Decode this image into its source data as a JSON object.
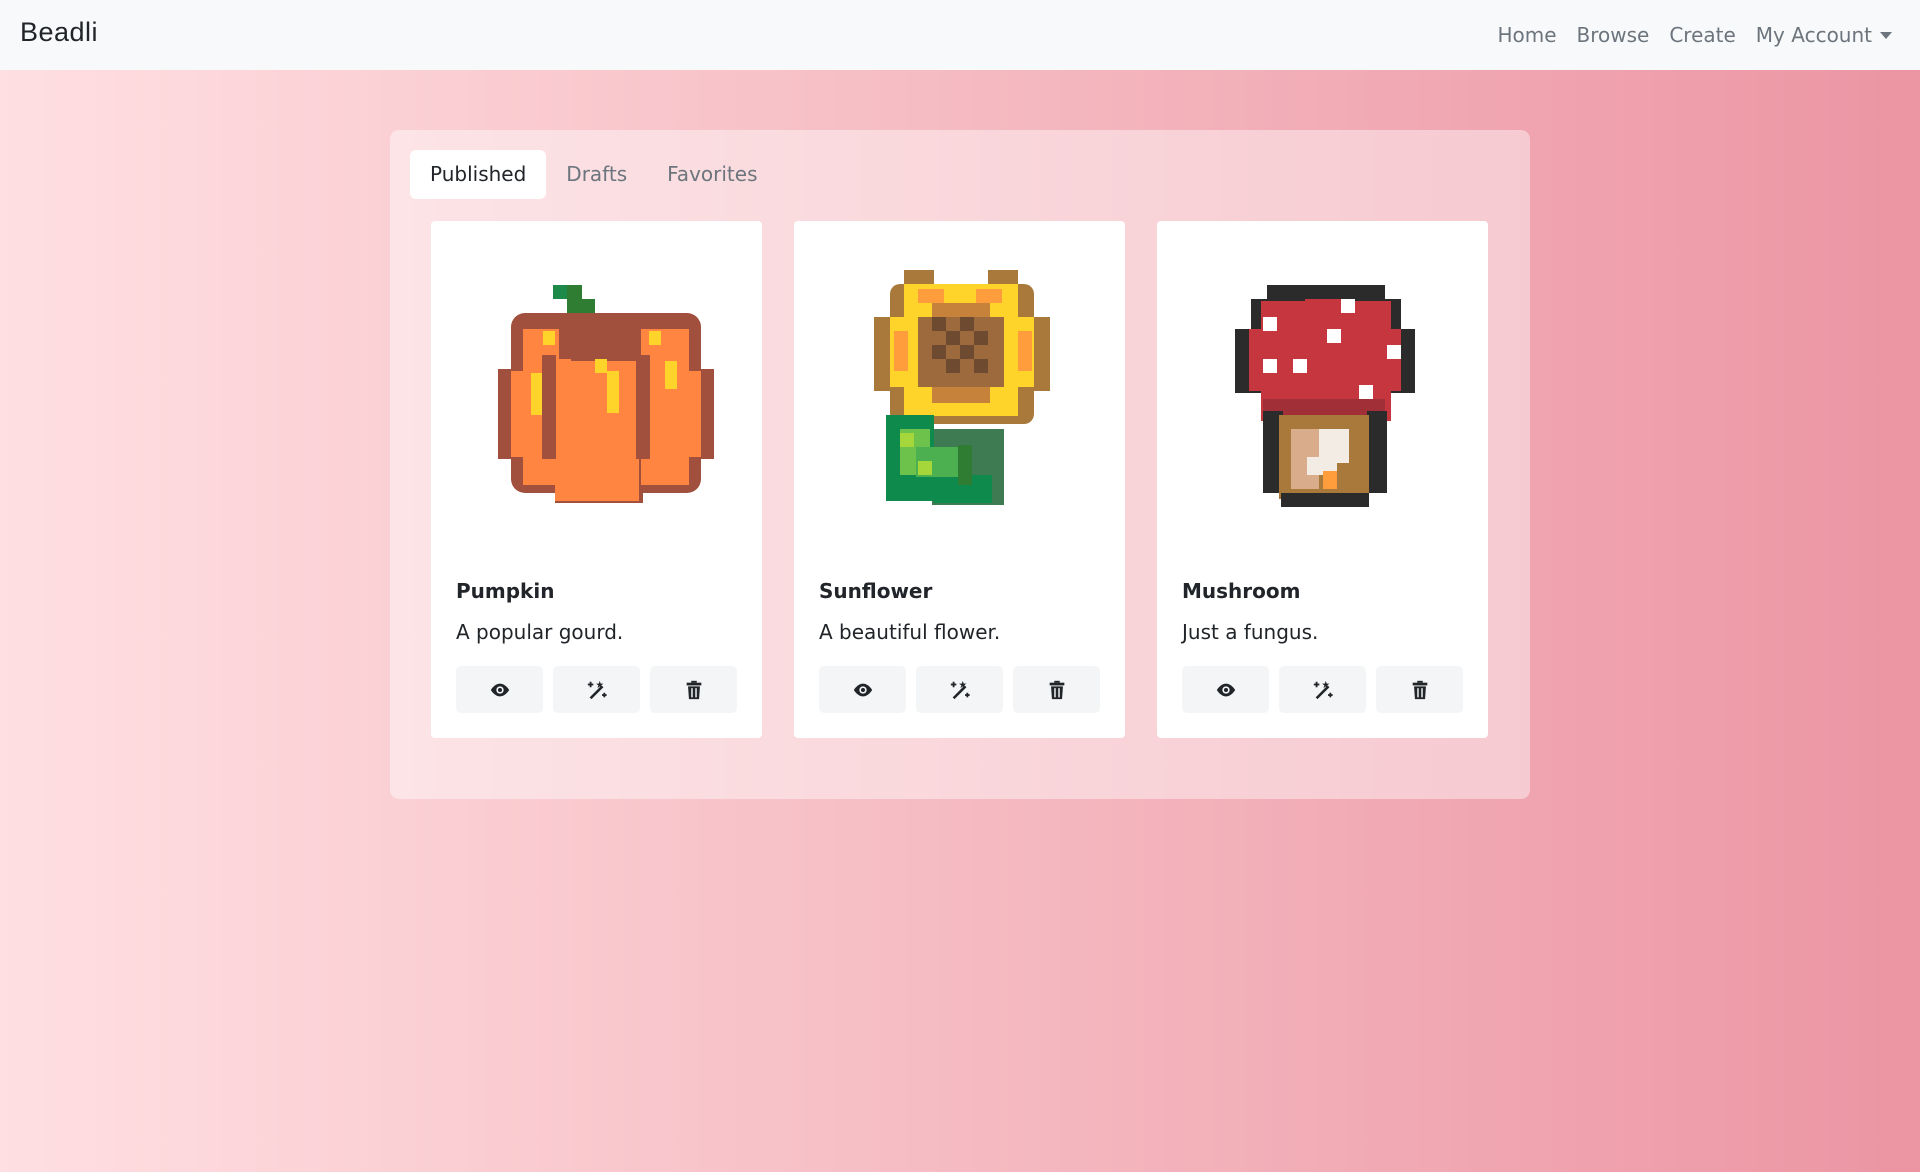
{
  "nav": {
    "brand": "Beadli",
    "links": [
      "Home",
      "Browse",
      "Create",
      "My Account"
    ]
  },
  "tabs": [
    {
      "label": "Published",
      "active": true
    },
    {
      "label": "Drafts",
      "active": false
    },
    {
      "label": "Favorites",
      "active": false
    }
  ],
  "cards": [
    {
      "title": "Pumpkin",
      "description": "A popular gourd.",
      "art": "pumpkin"
    },
    {
      "title": "Sunflower",
      "description": "A beautiful flower.",
      "art": "sunflower"
    },
    {
      "title": "Mushroom",
      "description": "Just a fungus.",
      "art": "mushroom"
    }
  ],
  "card_actions": [
    "eye-icon",
    "magic-wand-icon",
    "trash-icon"
  ],
  "colors": {
    "background_start": "#ffdfe2",
    "background_end": "#ec95a3",
    "navbar": "#f8f9fa",
    "nav_link": "#6c757d"
  }
}
